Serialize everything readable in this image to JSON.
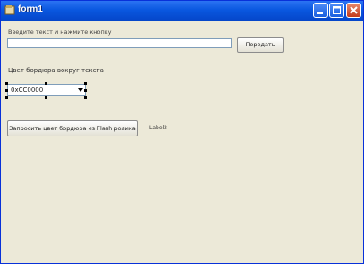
{
  "window": {
    "title": "form1"
  },
  "form": {
    "prompt_label": "Введите текст и нажмите кнопку",
    "text_value": "",
    "send_button": "Передать",
    "border_color_label": "Цвет бордюра вокруг текста",
    "border_color_value": "0xCC0000",
    "request_button": "Запросить цвет бордюра из Flash ролика",
    "status_label": "Label2"
  }
}
